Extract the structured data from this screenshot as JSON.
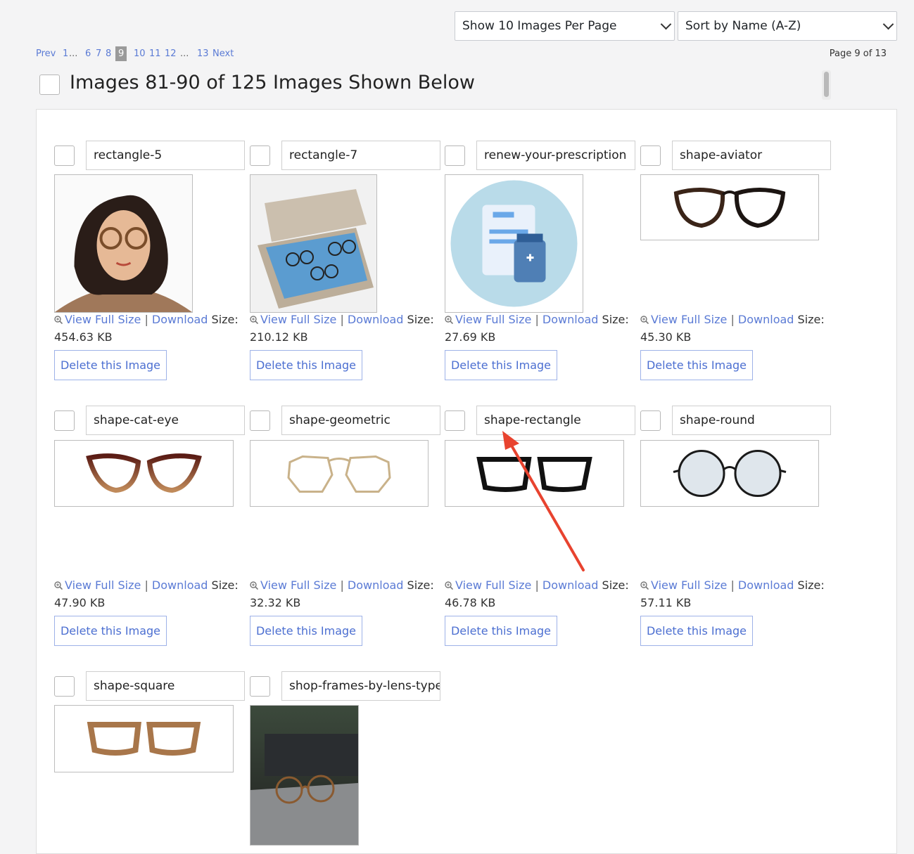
{
  "per_page_select": {
    "value": "Show 10 Images Per Page"
  },
  "sort_select": {
    "value": "Sort by Name (A-Z)"
  },
  "pagination": {
    "prev": "Prev",
    "pages": [
      "1",
      "...",
      "6",
      "7",
      "8",
      "9",
      "10",
      "11",
      "12",
      "...",
      "13"
    ],
    "current": "9",
    "next": "Next",
    "info": "Page 9 of 13"
  },
  "heading": "Images 81-90 of 125 Images Shown Below",
  "labels": {
    "view_full_size": "View Full Size",
    "download": "Download",
    "separator": "|",
    "size": "Size:",
    "delete": "Delete this Image"
  },
  "images": [
    {
      "name": "rectangle-5",
      "size": "454.63 KB"
    },
    {
      "name": "rectangle-7",
      "size": "210.12 KB"
    },
    {
      "name": "renew-your-prescription",
      "size": "27.69 KB"
    },
    {
      "name": "shape-aviator",
      "size": "45.30 KB"
    },
    {
      "name": "shape-cat-eye",
      "size": "47.90 KB"
    },
    {
      "name": "shape-geometric",
      "size": "32.32 KB"
    },
    {
      "name": "shape-rectangle",
      "size": "46.78 KB"
    },
    {
      "name": "shape-round",
      "size": "57.11 KB"
    },
    {
      "name": "shape-square",
      "size": ""
    },
    {
      "name": "shop-frames-by-lens-type",
      "size": ""
    }
  ],
  "colors": {
    "link": "#5b7bd5",
    "annotation_arrow": "#e8432f"
  }
}
